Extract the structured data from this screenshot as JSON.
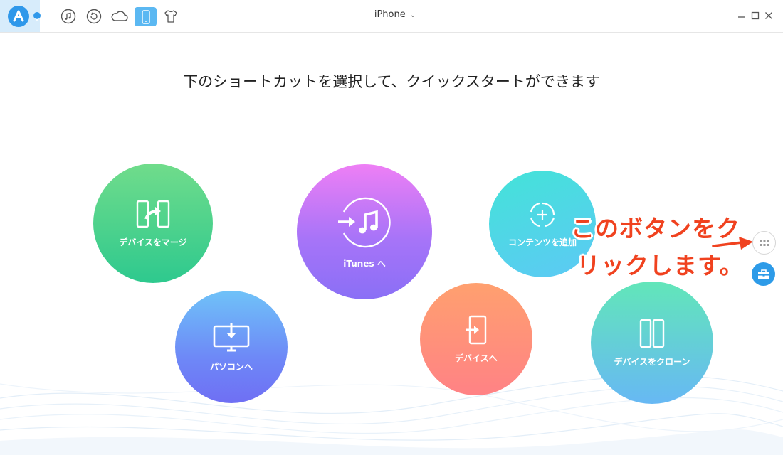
{
  "header": {
    "device_name": "iPhone",
    "chevron": "⌄",
    "toolbar_icons": [
      "music-icon",
      "restore-icon",
      "cloud-icon",
      "device-icon",
      "shirt-icon"
    ]
  },
  "main": {
    "headline": "下のショートカットを選択して、クイックスタートができます",
    "shortcuts": [
      {
        "label": "デバイスをマージ",
        "icon": "merge-icon"
      },
      {
        "label": "iTunes へ",
        "icon": "itunes-icon"
      },
      {
        "label": "コンテンツを追加",
        "icon": "add-content-icon"
      },
      {
        "label": "パソコンへ",
        "icon": "computer-icon"
      },
      {
        "label": "デバイスへ",
        "icon": "to-device-icon"
      },
      {
        "label": "デバイスをクローン",
        "icon": "clone-icon"
      }
    ]
  },
  "annotation": {
    "line1": "このボタンをク",
    "line2": "リックします。",
    "color": "#f0421f"
  },
  "colors": {
    "accent": "#2f98ea",
    "active_tab": "#5bb8f2"
  }
}
